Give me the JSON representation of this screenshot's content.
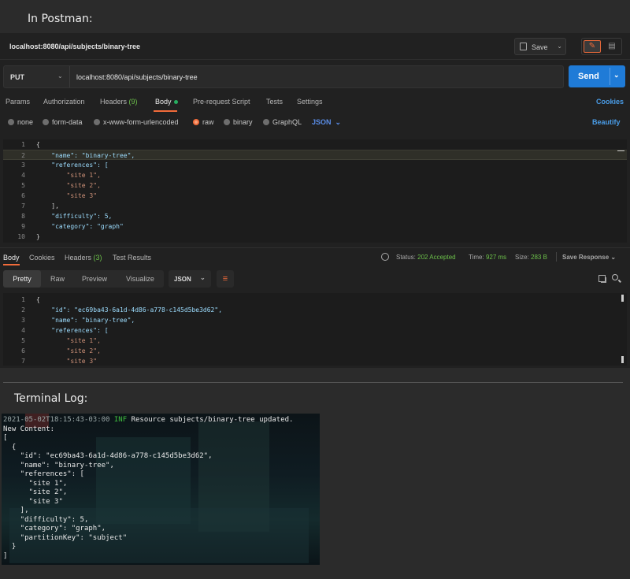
{
  "headings": {
    "postman": "In Postman:",
    "terminal": "Terminal Log:"
  },
  "titlebar": {
    "path": "localhost:8080/api/subjects/binary-tree",
    "save_label": "Save"
  },
  "request": {
    "method": "PUT",
    "url": "localhost:8080/api/subjects/binary-tree",
    "send_label": "Send"
  },
  "tabs": [
    {
      "label": "Params"
    },
    {
      "label": "Authorization"
    },
    {
      "label": "Headers",
      "count": "(9)"
    },
    {
      "label": "Body"
    },
    {
      "label": "Pre-request Script"
    },
    {
      "label": "Tests"
    },
    {
      "label": "Settings"
    }
  ],
  "cookies_label": "Cookies",
  "body_types": [
    "none",
    "form-data",
    "x-www-form-urlencoded",
    "raw",
    "binary",
    "GraphQL"
  ],
  "body_format": "JSON",
  "beautify_label": "Beautify",
  "request_body": {
    "line_numbers": [
      "1",
      "2",
      "3",
      "4",
      "5",
      "6",
      "7",
      "8",
      "9",
      "10"
    ],
    "lines": [
      "{",
      "    \"name\": \"binary-tree\",",
      "    \"references\": [",
      "        \"site 1\",",
      "        \"site 2\",",
      "        \"site 3\"",
      "    ],",
      "    \"difficulty\": 5,",
      "    \"category\": \"graph\"",
      "}"
    ]
  },
  "response_tabs": [
    {
      "label": "Body"
    },
    {
      "label": "Cookies"
    },
    {
      "label": "Headers",
      "count": "(3)"
    },
    {
      "label": "Test Results"
    }
  ],
  "response_status": {
    "status_label": "Status:",
    "status_value": "202 Accepted",
    "time_label": "Time:",
    "time_value": "927 ms",
    "size_label": "Size:",
    "size_value": "283 B",
    "save_response": "Save Response"
  },
  "view_modes": [
    "Pretty",
    "Raw",
    "Preview",
    "Visualize"
  ],
  "response_format": "JSON",
  "response_body": {
    "line_numbers": [
      "1",
      "2",
      "3",
      "4",
      "5",
      "6",
      "7"
    ],
    "lines": [
      "{",
      "    \"id\": \"ec69ba43-6a1d-4d86-a778-c145d5be3d62\",",
      "    \"name\": \"binary-tree\",",
      "    \"references\": [",
      "        \"site 1\",",
      "        \"site 2\",",
      "        \"site 3\""
    ]
  },
  "terminal": {
    "timestamp": "2021-05-02T18:15:43-03:00",
    "level": "INF",
    "message": "Resource subjects/binary-tree updated.",
    "lines": [
      "New Content:",
      "[",
      "  {",
      "    \"id\": \"ec69ba43-6a1d-4d86-a778-c145d5be3d62\",",
      "    \"name\": \"binary-tree\",",
      "    \"references\": [",
      "      \"site 1\",",
      "      \"site 2\",",
      "      \"site 3\"",
      "    ],",
      "    \"difficulty\": 5,",
      "    \"category\": \"graph\",",
      "    \"partitionKey\": \"subject\"",
      "  }",
      "]"
    ]
  },
  "colors": {
    "accent": "#f26b3a",
    "link": "#4a9de8",
    "send": "#1f7bd7",
    "ok": "#6cc04a"
  }
}
